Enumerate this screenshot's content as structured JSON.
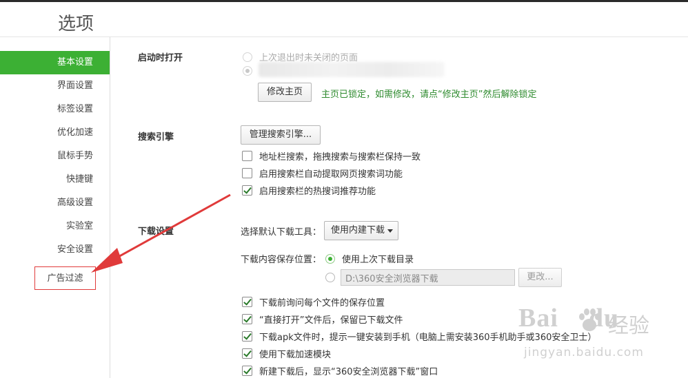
{
  "window": {
    "title": "选项"
  },
  "sidebar": {
    "items": [
      {
        "label": "基本设置",
        "active": true
      },
      {
        "label": "界面设置"
      },
      {
        "label": "标签设置"
      },
      {
        "label": "优化加速"
      },
      {
        "label": "鼠标手势"
      },
      {
        "label": "快捷键"
      },
      {
        "label": "高级设置"
      },
      {
        "label": "实验室"
      },
      {
        "label": "安全设置"
      },
      {
        "label": "广告过滤",
        "highlighted": true
      }
    ]
  },
  "startup": {
    "label": "启动时打开",
    "option_last_session": "上次退出时未关闭的页面",
    "modify_home_button": "修改主页",
    "locked_note": "主页已锁定，如需修改，请点“修改主页”然后解除锁定"
  },
  "search": {
    "label": "搜索引擎",
    "manage_button": "管理搜索引擎...",
    "opt_address_bar": "地址栏搜索，拖拽搜索与搜索栏保持一致",
    "opt_auto_extract": "启用搜索栏自动提取网页搜索词功能",
    "opt_hot_words": "启用搜索栏的热搜词推荐功能"
  },
  "download": {
    "label": "下载设置",
    "tool_label": "选择默认下载工具：",
    "tool_selected": "使用内建下载",
    "location_label": "下载内容保存位置：",
    "location_last": "使用上次下载目录",
    "location_path": "D:\\360安全浏览器下载",
    "change_button": "更改...",
    "opt_ask_location": "下载前询问每个文件的保存位置",
    "opt_keep_after_open": "“直接打开”文件后，保留已下载文件",
    "opt_apk": "下载apk文件时，提示一键安装到手机（电脑上需安装360手机助手或360安全卫士）",
    "opt_accelerate": "使用下载加速模块",
    "opt_show_window": "新建下载后，显示“360安全浏览器下载”窗口"
  },
  "watermark": {
    "logo": "Bai",
    "logo_tail": "du",
    "cn": "经验",
    "url": "jingyan.baidu.com"
  },
  "colors": {
    "accent": "#3cb034",
    "annotation_red": "#e03a3a",
    "locked_note_green": "#2d8a2d"
  }
}
